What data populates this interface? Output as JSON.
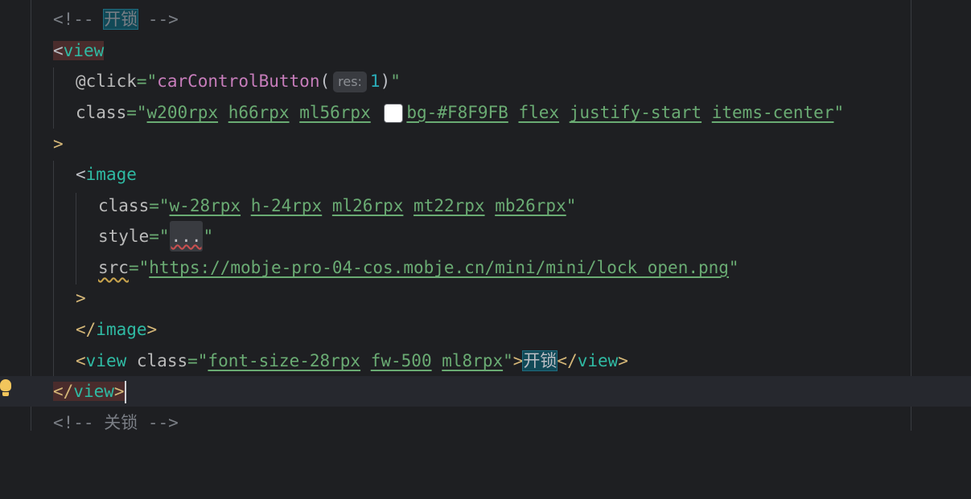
{
  "lines": [
    {
      "comment": "<!-- ",
      "word": "开锁",
      "end": " -->"
    },
    {
      "lt": "<",
      "name": "view"
    },
    {
      "attr": "@click",
      "eq": "=",
      "q": "\"",
      "fn": "carControlButton",
      "paren_open": "(",
      "hint": "res:",
      "num": "1",
      "paren_close": ")"
    },
    {
      "attr": "class",
      "eq": "=",
      "q": "\"",
      "classes_a": [
        "w200rpx",
        "h66rpx",
        "ml56rpx"
      ],
      "classes_b": [
        "bg-#F8F9FB",
        "flex",
        "justify-start",
        "items-center"
      ],
      "swatch_color": "#FFFFFF"
    },
    {
      "gt": ">"
    },
    {
      "lt": "<",
      "name": "image"
    },
    {
      "attr": "class",
      "eq": "=",
      "q": "\"",
      "classes": [
        "w-28rpx",
        "h-24rpx",
        "ml26rpx",
        "mt22rpx",
        "mb26rpx"
      ]
    },
    {
      "attr": "style",
      "eq": "=",
      "q": "\"",
      "folded": "..."
    },
    {
      "attr": "src",
      "eq": "=",
      "q": "\"",
      "url": "https://mobje-pro-04-cos.mobje.cn/mini/mini/lock_open.png"
    },
    {
      "gt": ">"
    },
    {
      "close_open": "</",
      "name": "image",
      "gt": ">"
    },
    {
      "lt": "<",
      "name": "view",
      "attr": "class",
      "eq": "=",
      "q": "\"",
      "classes": [
        "font-size-28rpx",
        "fw-500",
        "ml8rpx"
      ],
      "gt": ">",
      "word": "开锁",
      "close_open": "</",
      "close_name": "view"
    },
    {
      "close_open": "</",
      "name": "view",
      "gt": ">"
    },
    {
      "comment": "<!-- ",
      "word": "关锁",
      "end": " -->"
    }
  ]
}
